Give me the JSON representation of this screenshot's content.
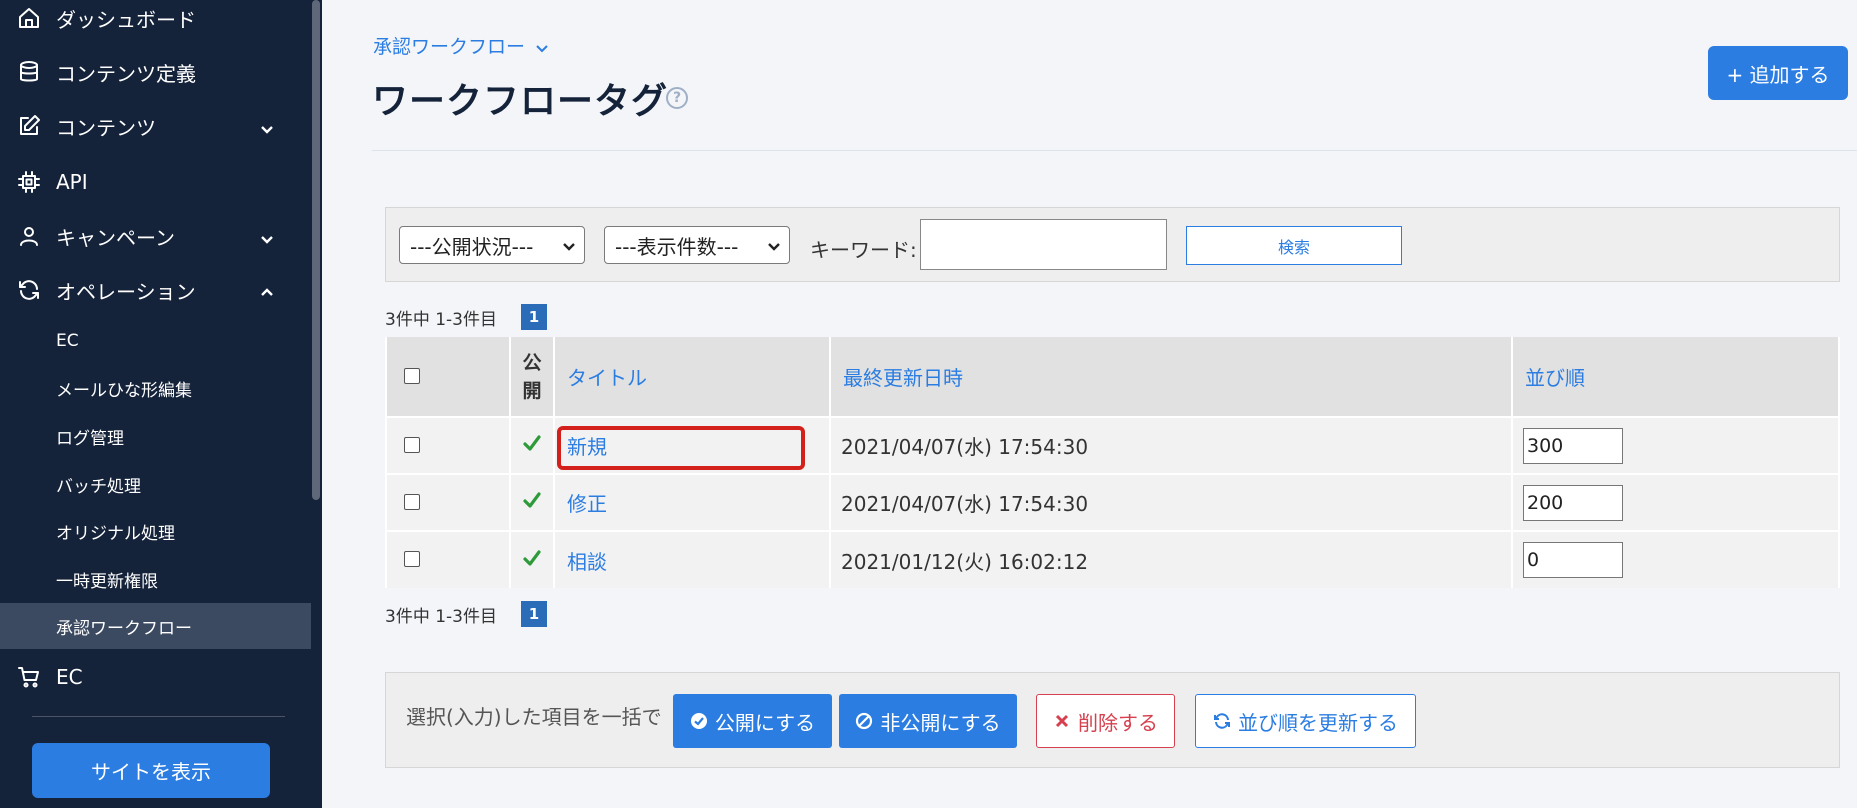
{
  "sidebar": {
    "items": [
      {
        "label": "ダッシュボード",
        "icon": "home-icon"
      },
      {
        "label": "コンテンツ定義",
        "icon": "database-icon"
      },
      {
        "label": "コンテンツ",
        "icon": "edit-icon"
      },
      {
        "label": "API",
        "icon": "chip-icon"
      },
      {
        "label": "キャンペーン",
        "icon": "user-icon"
      },
      {
        "label": "オペレーション",
        "icon": "refresh-icon"
      },
      {
        "label": "EC",
        "icon": "cart-icon"
      }
    ],
    "sub_items": [
      "EC",
      "メールひな形編集",
      "ログ管理",
      "バッチ処理",
      "オリジナル処理",
      "一時更新権限",
      "承認ワークフロー"
    ],
    "site_button": "サイトを表示"
  },
  "header": {
    "breadcrumb": "承認ワークフロー",
    "title": "ワークフロータグ",
    "help": "?",
    "add_button": "+ 追加する"
  },
  "filter": {
    "status_select": "---公開状況---",
    "count_select": "---表示件数---",
    "keyword_label": "キーワード:",
    "keyword_value": "",
    "search_button": "検索"
  },
  "pagination": {
    "summary": "3件中 1-3件目",
    "current_page": "1"
  },
  "table": {
    "columns": {
      "public": "公開",
      "title": "タイトル",
      "updated": "最終更新日時",
      "order": "並び順"
    },
    "rows": [
      {
        "title": "新規",
        "updated": "2021/04/07(水) 17:54:30",
        "order": "300"
      },
      {
        "title": "修正",
        "updated": "2021/04/07(水) 17:54:30",
        "order": "200"
      },
      {
        "title": "相談",
        "updated": "2021/01/12(火) 16:02:12",
        "order": "0"
      }
    ]
  },
  "bulk": {
    "label": "選択(入力)した項目を一括で",
    "publish": "公開にする",
    "unpublish": "非公開にする",
    "delete": "削除する",
    "update_order": "並び順を更新する"
  },
  "colors": {
    "accent": "#2b7de2",
    "sidebar": "#14223a",
    "danger": "#d6404f",
    "check": "#2e9a3a",
    "highlight": "#d4201a"
  }
}
